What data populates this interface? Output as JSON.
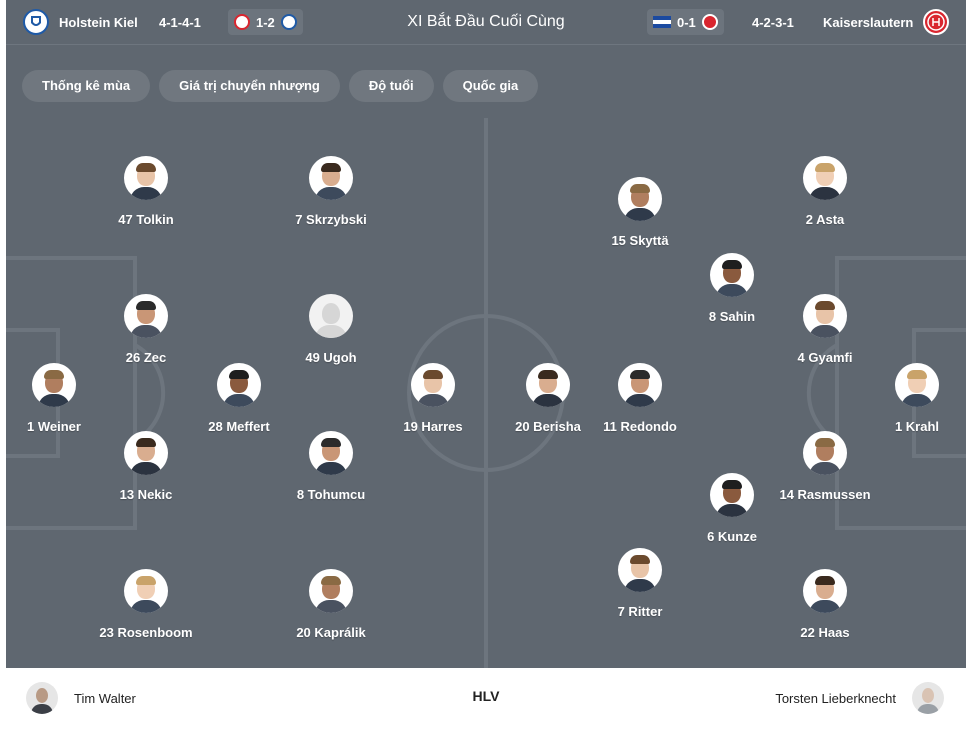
{
  "header": {
    "home_team": {
      "name": "Holstein Kiel",
      "formation": "4-1-4-1",
      "crest": "holstein-kiel-crest",
      "color": "#1f5aa6"
    },
    "home_last": {
      "score": "1-2",
      "opponent_crest": "fortuna-duesseldorf-crest",
      "color": "#d9262f"
    },
    "title": "XI Bắt Đầu Cuối Cùng",
    "away_last": {
      "score": "0-1",
      "opponent_crest": "hertha-bsc-crest",
      "color": "#1b4aa0"
    },
    "away_team": {
      "name": "Kaiserslautern",
      "formation": "4-2-3-1",
      "crest": "kaiserslautern-crest",
      "color": "#d9262f"
    }
  },
  "tabs": [
    {
      "label": "Thống kê mùa"
    },
    {
      "label": "Giá trị chuyển nhượng"
    },
    {
      "label": "Độ tuổi"
    },
    {
      "label": "Quốc gia"
    }
  ],
  "home_players": [
    {
      "label": "47 Tolkin"
    },
    {
      "label": "7 Skrzybski"
    },
    {
      "label": "26 Zec"
    },
    {
      "label": "49 Ugoh"
    },
    {
      "label": "1 Weiner"
    },
    {
      "label": "28 Meffert"
    },
    {
      "label": "19 Harres"
    },
    {
      "label": "13 Nekic"
    },
    {
      "label": "8 Tohumcu"
    },
    {
      "label": "23 Rosenboom"
    },
    {
      "label": "20 Kaprálik"
    }
  ],
  "away_players": [
    {
      "label": "2 Asta"
    },
    {
      "label": "15 Skyttä"
    },
    {
      "label": "8 Sahin"
    },
    {
      "label": "4 Gyamfi"
    },
    {
      "label": "20 Berisha"
    },
    {
      "label": "11 Redondo"
    },
    {
      "label": "1 Krahl"
    },
    {
      "label": "14 Rasmussen"
    },
    {
      "label": "6 Kunze"
    },
    {
      "label": "7 Ritter"
    },
    {
      "label": "22 Haas"
    }
  ],
  "coaches": {
    "home": "Tim Walter",
    "label": "HLV",
    "away": "Torsten Lieberknecht"
  }
}
